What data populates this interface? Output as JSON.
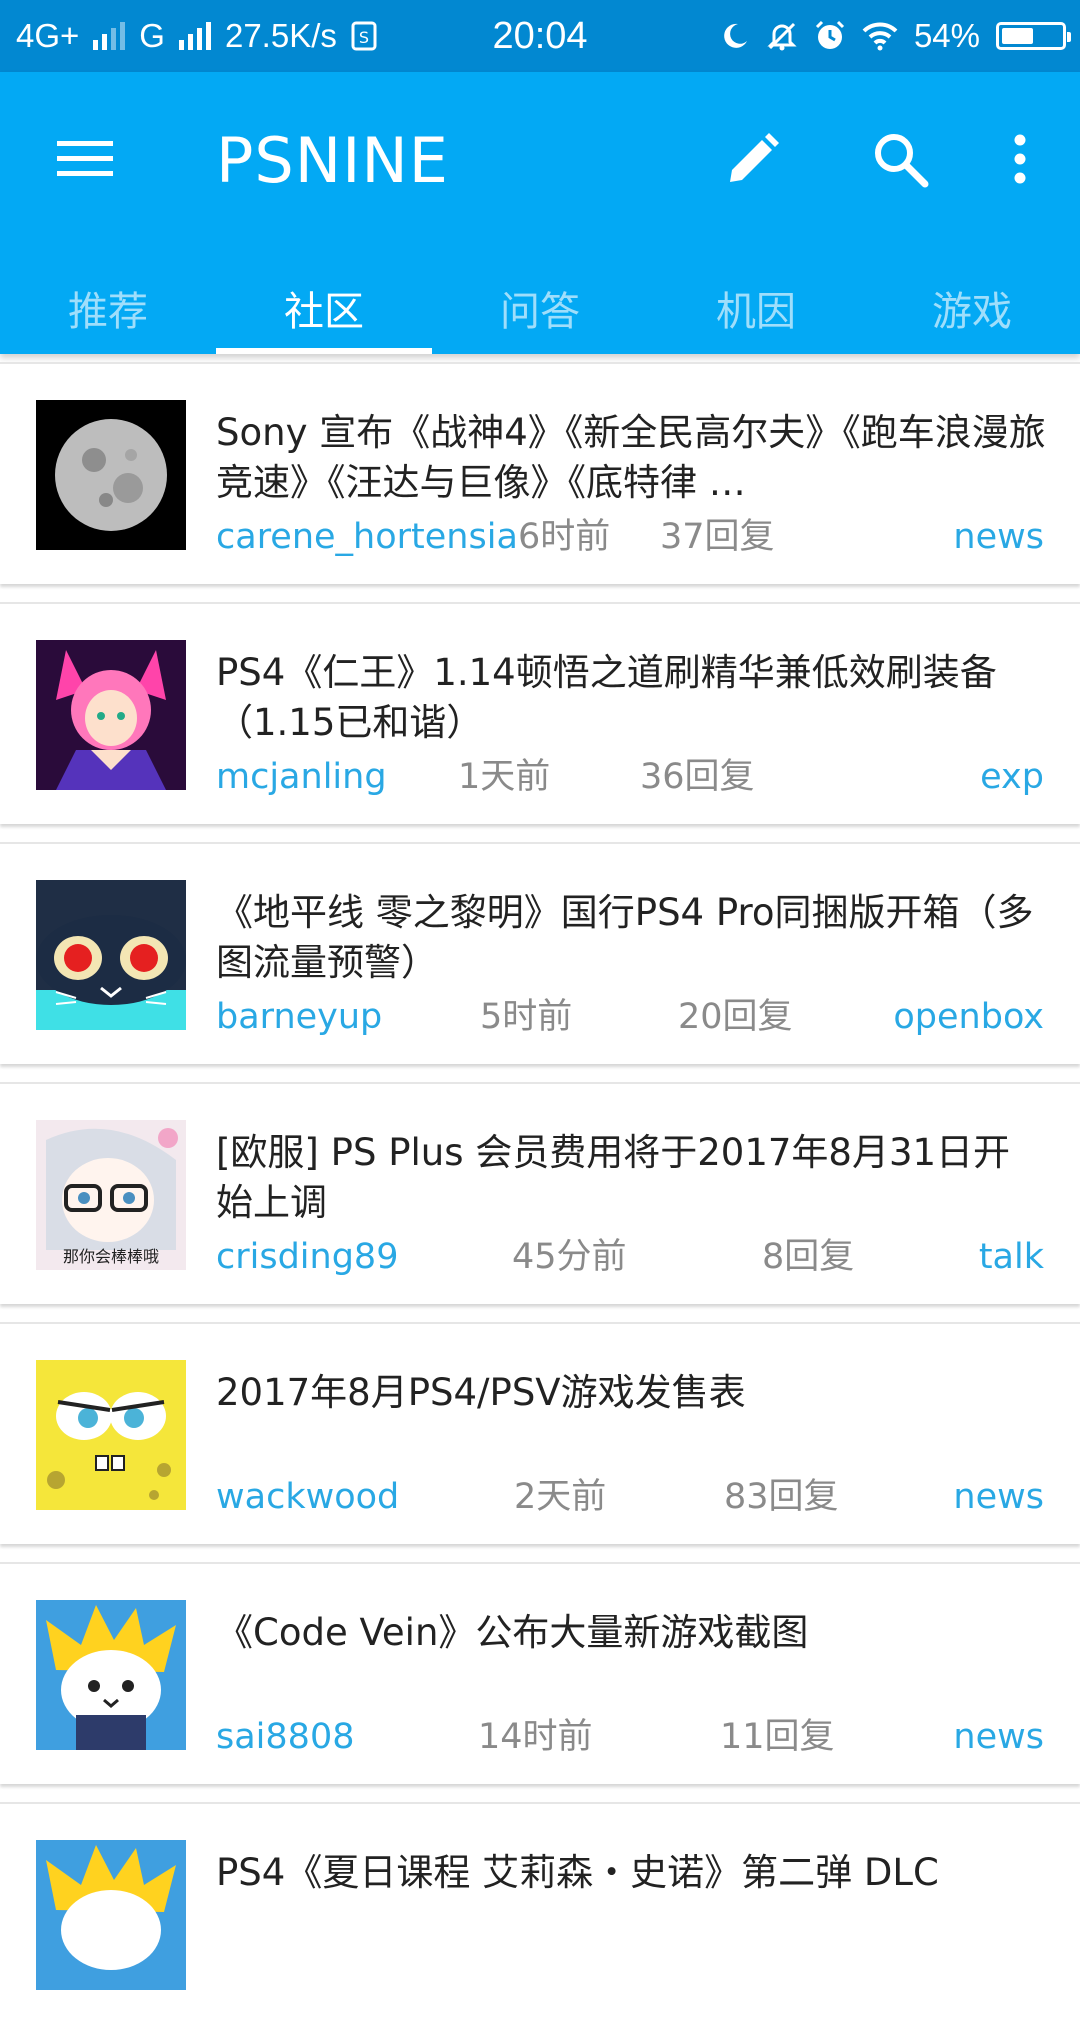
{
  "status_bar": {
    "network1": "4G+",
    "network2": "G",
    "speed": "27.5K/s",
    "time": "20:04",
    "battery_percent": "54%",
    "battery_level": 0.54
  },
  "app_bar": {
    "title": "PSNINE",
    "color": "#03a9f4",
    "tabs": [
      "推荐",
      "社区",
      "问答",
      "机因",
      "游戏"
    ],
    "active_tab": 1
  },
  "topics": [
    {
      "title": "Sony 宣布《战神4》《新全民高尔夫》《跑车浪漫旅 竞速》《汪达与巨像》《底特律 …",
      "author": "carene_hortensia",
      "time": "6时前",
      "replies": "37回复",
      "tag": "news",
      "avatar": "moon-avatar"
    },
    {
      "title": "PS4《仁王》1.14顿悟之道刷精华兼低效刷装备（1.15已和谐）",
      "author": "mcjanling",
      "time": "1天前",
      "replies": "36回复",
      "tag": "exp",
      "avatar": "fox-girl-avatar"
    },
    {
      "title": "《地平线 零之黎明》国行PS4 Pro同捆版开箱（多图流量预警）",
      "author": "barneyup",
      "time": "5时前",
      "replies": "20回复",
      "tag": "openbox",
      "avatar": "cat-avatar"
    },
    {
      "title": "[欧服] PS Plus 会员费用将于2017年8月31日开始上调",
      "author": "crisding89",
      "time": "45分前",
      "replies": "8回复",
      "tag": "talk",
      "avatar": "anime-girl-avatar",
      "avatar_caption": "那你会棒棒哦"
    },
    {
      "title": "2017年8月PS4/PSV游戏发售表",
      "author": "wackwood",
      "time": "2天前",
      "replies": "83回复",
      "tag": "news",
      "avatar": "sponge-avatar"
    },
    {
      "title": "《Code Vein》公布大量新游戏截图",
      "author": "sai8808",
      "time": "14时前",
      "replies": "11回复",
      "tag": "news",
      "avatar": "spiky-cat-avatar"
    },
    {
      "title": "PS4《夏日课程 艾莉森・史诺》第二弹 DLC",
      "author": "",
      "time": "",
      "replies": "",
      "tag": "",
      "avatar": "spiky-cat-avatar"
    }
  ]
}
